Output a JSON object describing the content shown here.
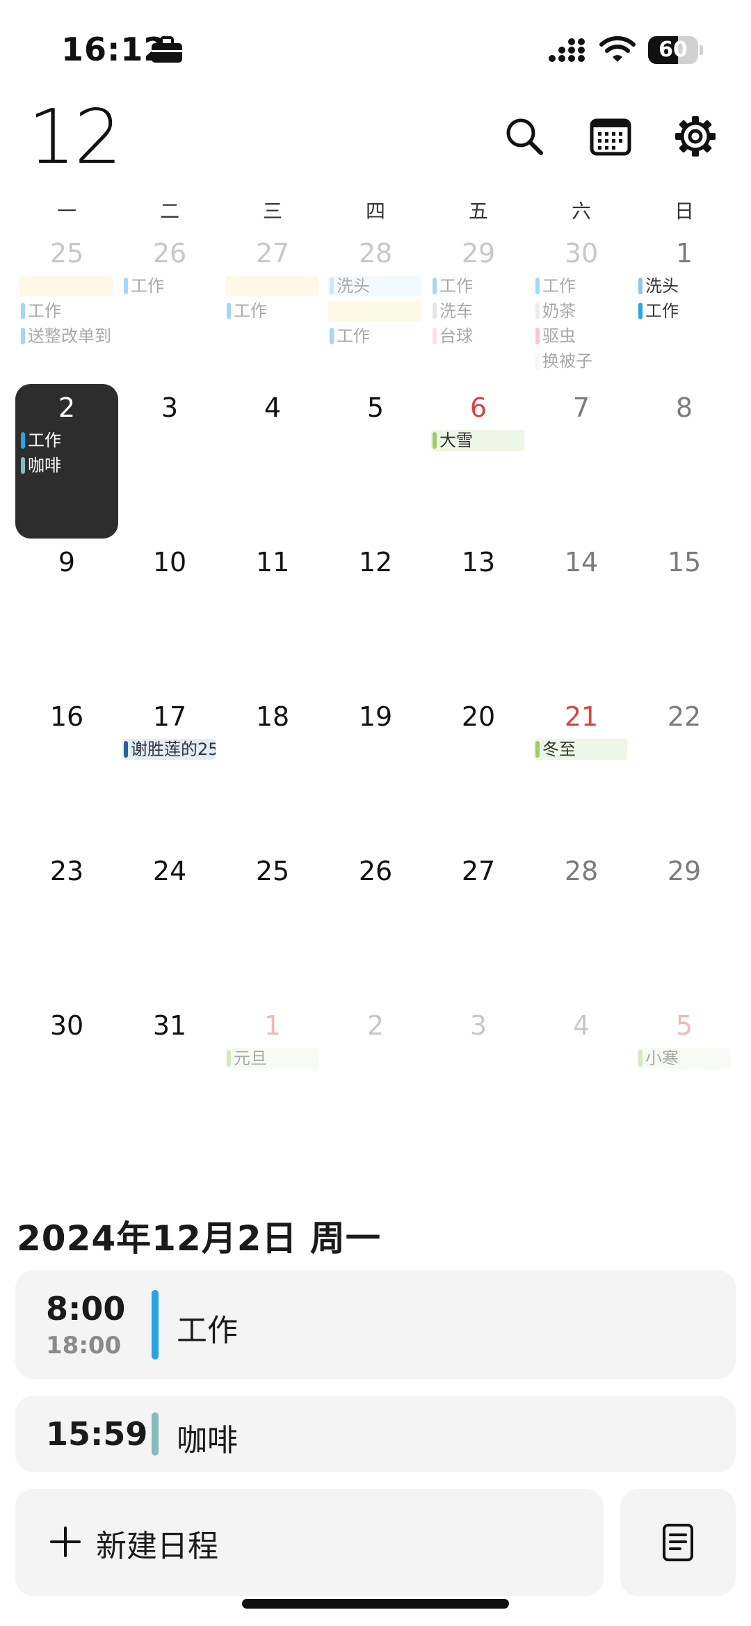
{
  "status_bar": {
    "time": "16:12",
    "battery_level": 60,
    "battery_text": "60"
  },
  "header": {
    "month": "12"
  },
  "weekdays": [
    "一",
    "二",
    "三",
    "四",
    "五",
    "六",
    "日"
  ],
  "colors": {
    "work": "#29a3e6",
    "coffee": "#86bcbc",
    "hair": "#8fc6ea",
    "snow": "#9ccc6b",
    "car": "#c5c5c5",
    "tea": "#d5d5d5",
    "pool": "#f3b9c9",
    "bug": "#e57fa0",
    "quilt": "#e8e8f4",
    "birthday": "#2f5e9c",
    "holiday_fill": "#eef6e6",
    "birthday_fill": "#e4ecf6",
    "yellow_fill": "#fdf1c6",
    "selected_bg": "#2d2d2d"
  },
  "calendar": {
    "days": [
      {
        "num": "25",
        "state": "other",
        "events": [
          {
            "label": "",
            "color": "#fdf1c6",
            "bg": "#fdf1c6"
          },
          {
            "label": "工作",
            "color": "#29a3e6"
          },
          {
            "label": "送整改单到",
            "color": "#29a3e6"
          }
        ]
      },
      {
        "num": "26",
        "state": "other",
        "events": [
          {
            "label": "工作",
            "color": "#29a3e6"
          }
        ]
      },
      {
        "num": "27",
        "state": "other",
        "events": [
          {
            "label": "",
            "color": "#fdf1c6",
            "bg": "#fdf1c6"
          },
          {
            "label": "工作",
            "color": "#29a3e6"
          }
        ]
      },
      {
        "num": "28",
        "state": "other",
        "events": [
          {
            "label": "洗头",
            "color": "#8fc6ea",
            "bg": "#e3f1fa"
          },
          {
            "label": "",
            "color": "#fdf1c6",
            "bg": "#fdf1c6"
          },
          {
            "label": "工作",
            "color": "#29a3e6"
          }
        ]
      },
      {
        "num": "29",
        "state": "other",
        "events": [
          {
            "label": "工作",
            "color": "#29a3e6"
          },
          {
            "label": "洗车",
            "color": "#c5c5c5"
          },
          {
            "label": "台球",
            "color": "#f3b9c9"
          }
        ]
      },
      {
        "num": "30",
        "state": "other weekend",
        "events": [
          {
            "label": "工作",
            "color": "#29a3e6"
          },
          {
            "label": "奶茶",
            "color": "#d5d5d5"
          },
          {
            "label": "驱虫",
            "color": "#e57fa0"
          },
          {
            "label": "换被子",
            "color": "#e8e8f4"
          }
        ]
      },
      {
        "num": "1",
        "state": "weekend",
        "events": [
          {
            "label": "洗头",
            "color": "#8fc6ea"
          },
          {
            "label": "工作",
            "color": "#29a3e6"
          }
        ]
      },
      {
        "num": "2",
        "state": "selected",
        "events": [
          {
            "label": "工作",
            "color": "#29a3e6"
          },
          {
            "label": "咖啡",
            "color": "#86bcbc"
          }
        ]
      },
      {
        "num": "3",
        "state": "",
        "events": []
      },
      {
        "num": "4",
        "state": "",
        "events": []
      },
      {
        "num": "5",
        "state": "",
        "events": []
      },
      {
        "num": "6",
        "state": "holiday",
        "events": [
          {
            "label": "大雪",
            "color": "#9ccc6b",
            "bg": "#eef6e6"
          }
        ]
      },
      {
        "num": "7",
        "state": "weekend",
        "events": []
      },
      {
        "num": "8",
        "state": "weekend",
        "events": []
      },
      {
        "num": "9",
        "state": "",
        "events": []
      },
      {
        "num": "10",
        "state": "",
        "events": []
      },
      {
        "num": "11",
        "state": "",
        "events": []
      },
      {
        "num": "12",
        "state": "",
        "events": []
      },
      {
        "num": "13",
        "state": "",
        "events": []
      },
      {
        "num": "14",
        "state": "weekend",
        "events": []
      },
      {
        "num": "15",
        "state": "weekend",
        "events": []
      },
      {
        "num": "16",
        "state": "",
        "events": []
      },
      {
        "num": "17",
        "state": "",
        "events": [
          {
            "label": "谢胜莲的25",
            "color": "#2f5e9c",
            "bg": "#e4ecf6"
          }
        ]
      },
      {
        "num": "18",
        "state": "",
        "events": []
      },
      {
        "num": "19",
        "state": "",
        "events": []
      },
      {
        "num": "20",
        "state": "",
        "events": []
      },
      {
        "num": "21",
        "state": "holiday",
        "events": [
          {
            "label": "冬至",
            "color": "#9ccc6b",
            "bg": "#eef6e6"
          }
        ]
      },
      {
        "num": "22",
        "state": "weekend",
        "events": []
      },
      {
        "num": "23",
        "state": "",
        "events": []
      },
      {
        "num": "24",
        "state": "",
        "events": []
      },
      {
        "num": "25",
        "state": "",
        "events": []
      },
      {
        "num": "26",
        "state": "",
        "events": []
      },
      {
        "num": "27",
        "state": "",
        "events": []
      },
      {
        "num": "28",
        "state": "weekend",
        "events": []
      },
      {
        "num": "29",
        "state": "weekend",
        "events": []
      },
      {
        "num": "30",
        "state": "",
        "events": []
      },
      {
        "num": "31",
        "state": "",
        "events": []
      },
      {
        "num": "1",
        "state": "other holiday",
        "events": [
          {
            "label": "元旦",
            "color": "#9ccc6b",
            "bg": "#eef6e6"
          }
        ]
      },
      {
        "num": "2",
        "state": "other",
        "events": []
      },
      {
        "num": "3",
        "state": "other",
        "events": []
      },
      {
        "num": "4",
        "state": "other",
        "events": []
      },
      {
        "num": "5",
        "state": "other holiday",
        "events": [
          {
            "label": "小寒",
            "color": "#9ccc6b",
            "bg": "#eef6e6"
          }
        ]
      }
    ]
  },
  "selected_date": "2024年12月2日 周一",
  "agenda": [
    {
      "start": "8:00",
      "end": "18:00",
      "title": "工作",
      "color": "#29a3e6"
    },
    {
      "start": "15:59",
      "end": "",
      "title": "咖啡",
      "color": "#86bcbc"
    }
  ],
  "actions": {
    "new_event": "新建日程"
  }
}
